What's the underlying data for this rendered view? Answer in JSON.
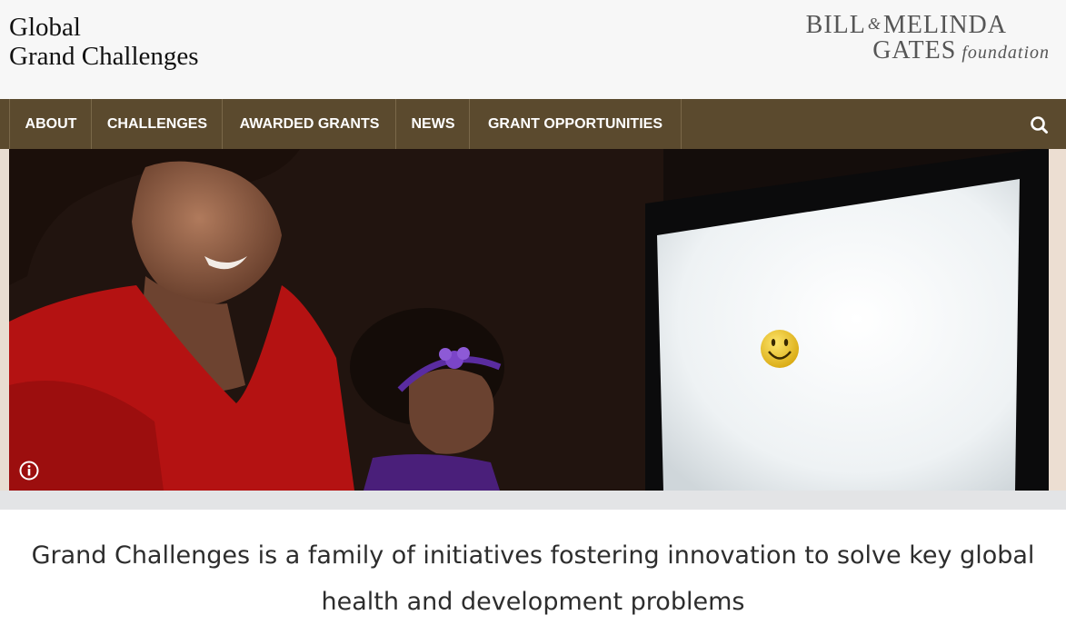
{
  "header": {
    "site_title_line1": "Global",
    "site_title_line2": "Grand Challenges",
    "partner_logo": {
      "line1_a": "BILL",
      "line1_amp": "&",
      "line1_b": "MELINDA",
      "line2_a": "GATES",
      "line2_b": "foundation"
    }
  },
  "nav": {
    "items": [
      {
        "label": "ABOUT"
      },
      {
        "label": "CHALLENGES"
      },
      {
        "label": "AWARDED GRANTS"
      },
      {
        "label": "NEWS"
      },
      {
        "label": "GRANT OPPORTUNITIES"
      }
    ],
    "search_icon": "search-icon"
  },
  "hero": {
    "info_icon": "info-icon"
  },
  "tagline": "Grand Challenges is a family of initiatives fostering innovation to solve key global health and development problems",
  "colors": {
    "nav_bg": "#5b4a2e",
    "header_bg": "#f7f7f7",
    "text_dark": "#2d2d2d"
  }
}
